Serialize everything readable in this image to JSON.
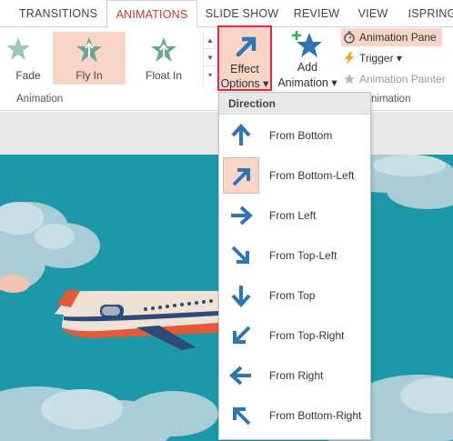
{
  "tabs": [
    "TRANSITIONS",
    "ANIMATIONS",
    "SLIDE SHOW",
    "REVIEW",
    "VIEW",
    "ISPRING"
  ],
  "active_tab": "ANIMATIONS",
  "gallery": [
    {
      "label": "Fade",
      "icon": "fade-star-icon"
    },
    {
      "label": "Fly In",
      "icon": "fly-in-star-icon",
      "selected": true
    },
    {
      "label": "Float In",
      "icon": "float-in-star-icon"
    }
  ],
  "effect_options": {
    "line1": "Effect",
    "line2": "Options ▾",
    "icon": "arrow-up-right-icon"
  },
  "add_animation": {
    "line1": "Add",
    "line2": "Animation ▾",
    "icon": "star-plus-icon"
  },
  "side_commands": {
    "animation_pane": "Animation Pane",
    "trigger": "Trigger ▾",
    "animation_painter": "Animation Painter"
  },
  "group_labels": {
    "animation": "Animation",
    "advanced": "nimation"
  },
  "dropdown": {
    "header": "Direction",
    "items": [
      {
        "label": "From Bottom",
        "icon": "arrow-up-icon"
      },
      {
        "label": "From Bottom-Left",
        "icon": "arrow-up-right-icon",
        "selected": true
      },
      {
        "label": "From Left",
        "icon": "arrow-right-icon"
      },
      {
        "label": "From Top-Left",
        "icon": "arrow-down-right-icon"
      },
      {
        "label": "From Top",
        "icon": "arrow-down-icon"
      },
      {
        "label": "From Top-Right",
        "icon": "arrow-down-left-icon"
      },
      {
        "label": "From Right",
        "icon": "arrow-left-icon"
      },
      {
        "label": "From Bottom-Right",
        "icon": "arrow-up-left-icon"
      }
    ]
  },
  "colors": {
    "accent_red": "#c0392b",
    "selection": "#f8d5c6",
    "highlight_border": "#e8254a",
    "icon_blue": "#2e75b6",
    "star_green": "#6aa690",
    "slide_bg": "#1c98a8"
  }
}
